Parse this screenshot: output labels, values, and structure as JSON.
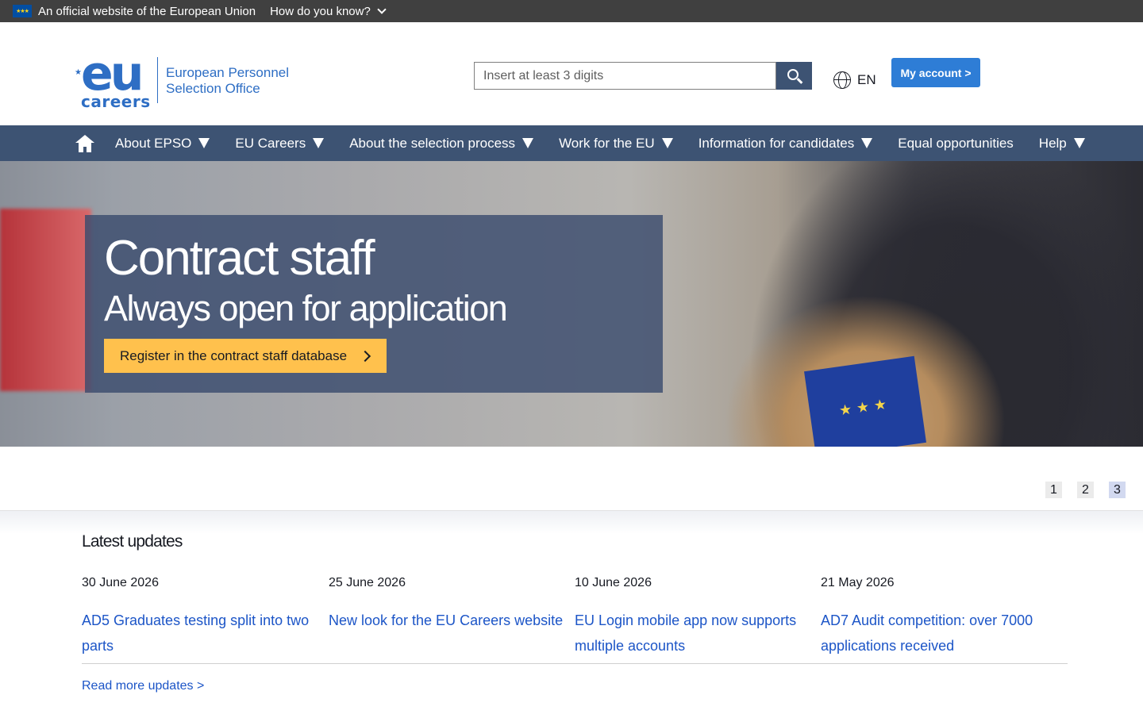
{
  "eu_bar": {
    "official_text": "An official website of the European Union",
    "how_label": "How do you know?"
  },
  "header": {
    "logo_eu": "eu",
    "logo_careers": "careers",
    "logo_text_line1": "European Personnel",
    "logo_text_line2": "Selection Office",
    "search_placeholder": "Insert at least 3 digits",
    "language": "EN",
    "my_account_label": "My account >"
  },
  "nav": {
    "items": [
      {
        "label": "About EPSO",
        "has_dropdown": true
      },
      {
        "label": "EU Careers",
        "has_dropdown": true
      },
      {
        "label": "About the selection process",
        "has_dropdown": true
      },
      {
        "label": "Work for the EU",
        "has_dropdown": true
      },
      {
        "label": "Information for candidates",
        "has_dropdown": true
      },
      {
        "label": "Equal opportunities",
        "has_dropdown": false
      },
      {
        "label": "Help",
        "has_dropdown": true
      }
    ]
  },
  "hero": {
    "title": "Contract staff",
    "subtitle": "Always open for application",
    "button_label": "Register in the contract staff database"
  },
  "pager": {
    "pages": [
      "1",
      "2",
      "3"
    ],
    "active": "3"
  },
  "updates": {
    "title": "Latest updates",
    "items": [
      {
        "date": "30 June 2026",
        "title": "AD5 Graduates testing split into two parts"
      },
      {
        "date": "25 June 2026",
        "title": "New look for the EU Careers website"
      },
      {
        "date": "10 June 2026",
        "title": "EU Login mobile app now supports multiple accounts"
      },
      {
        "date": "21 May 2026",
        "title": "AD7 Audit competition: over 7000 applications received"
      }
    ],
    "read_more_label": "Read more updates >"
  },
  "colors": {
    "nav_bg": "#3d5373",
    "accent_blue": "#2e7dd6",
    "link_blue": "#1c55c7",
    "cta_yellow": "#ffc14d",
    "eu_bar_bg": "#404040"
  }
}
